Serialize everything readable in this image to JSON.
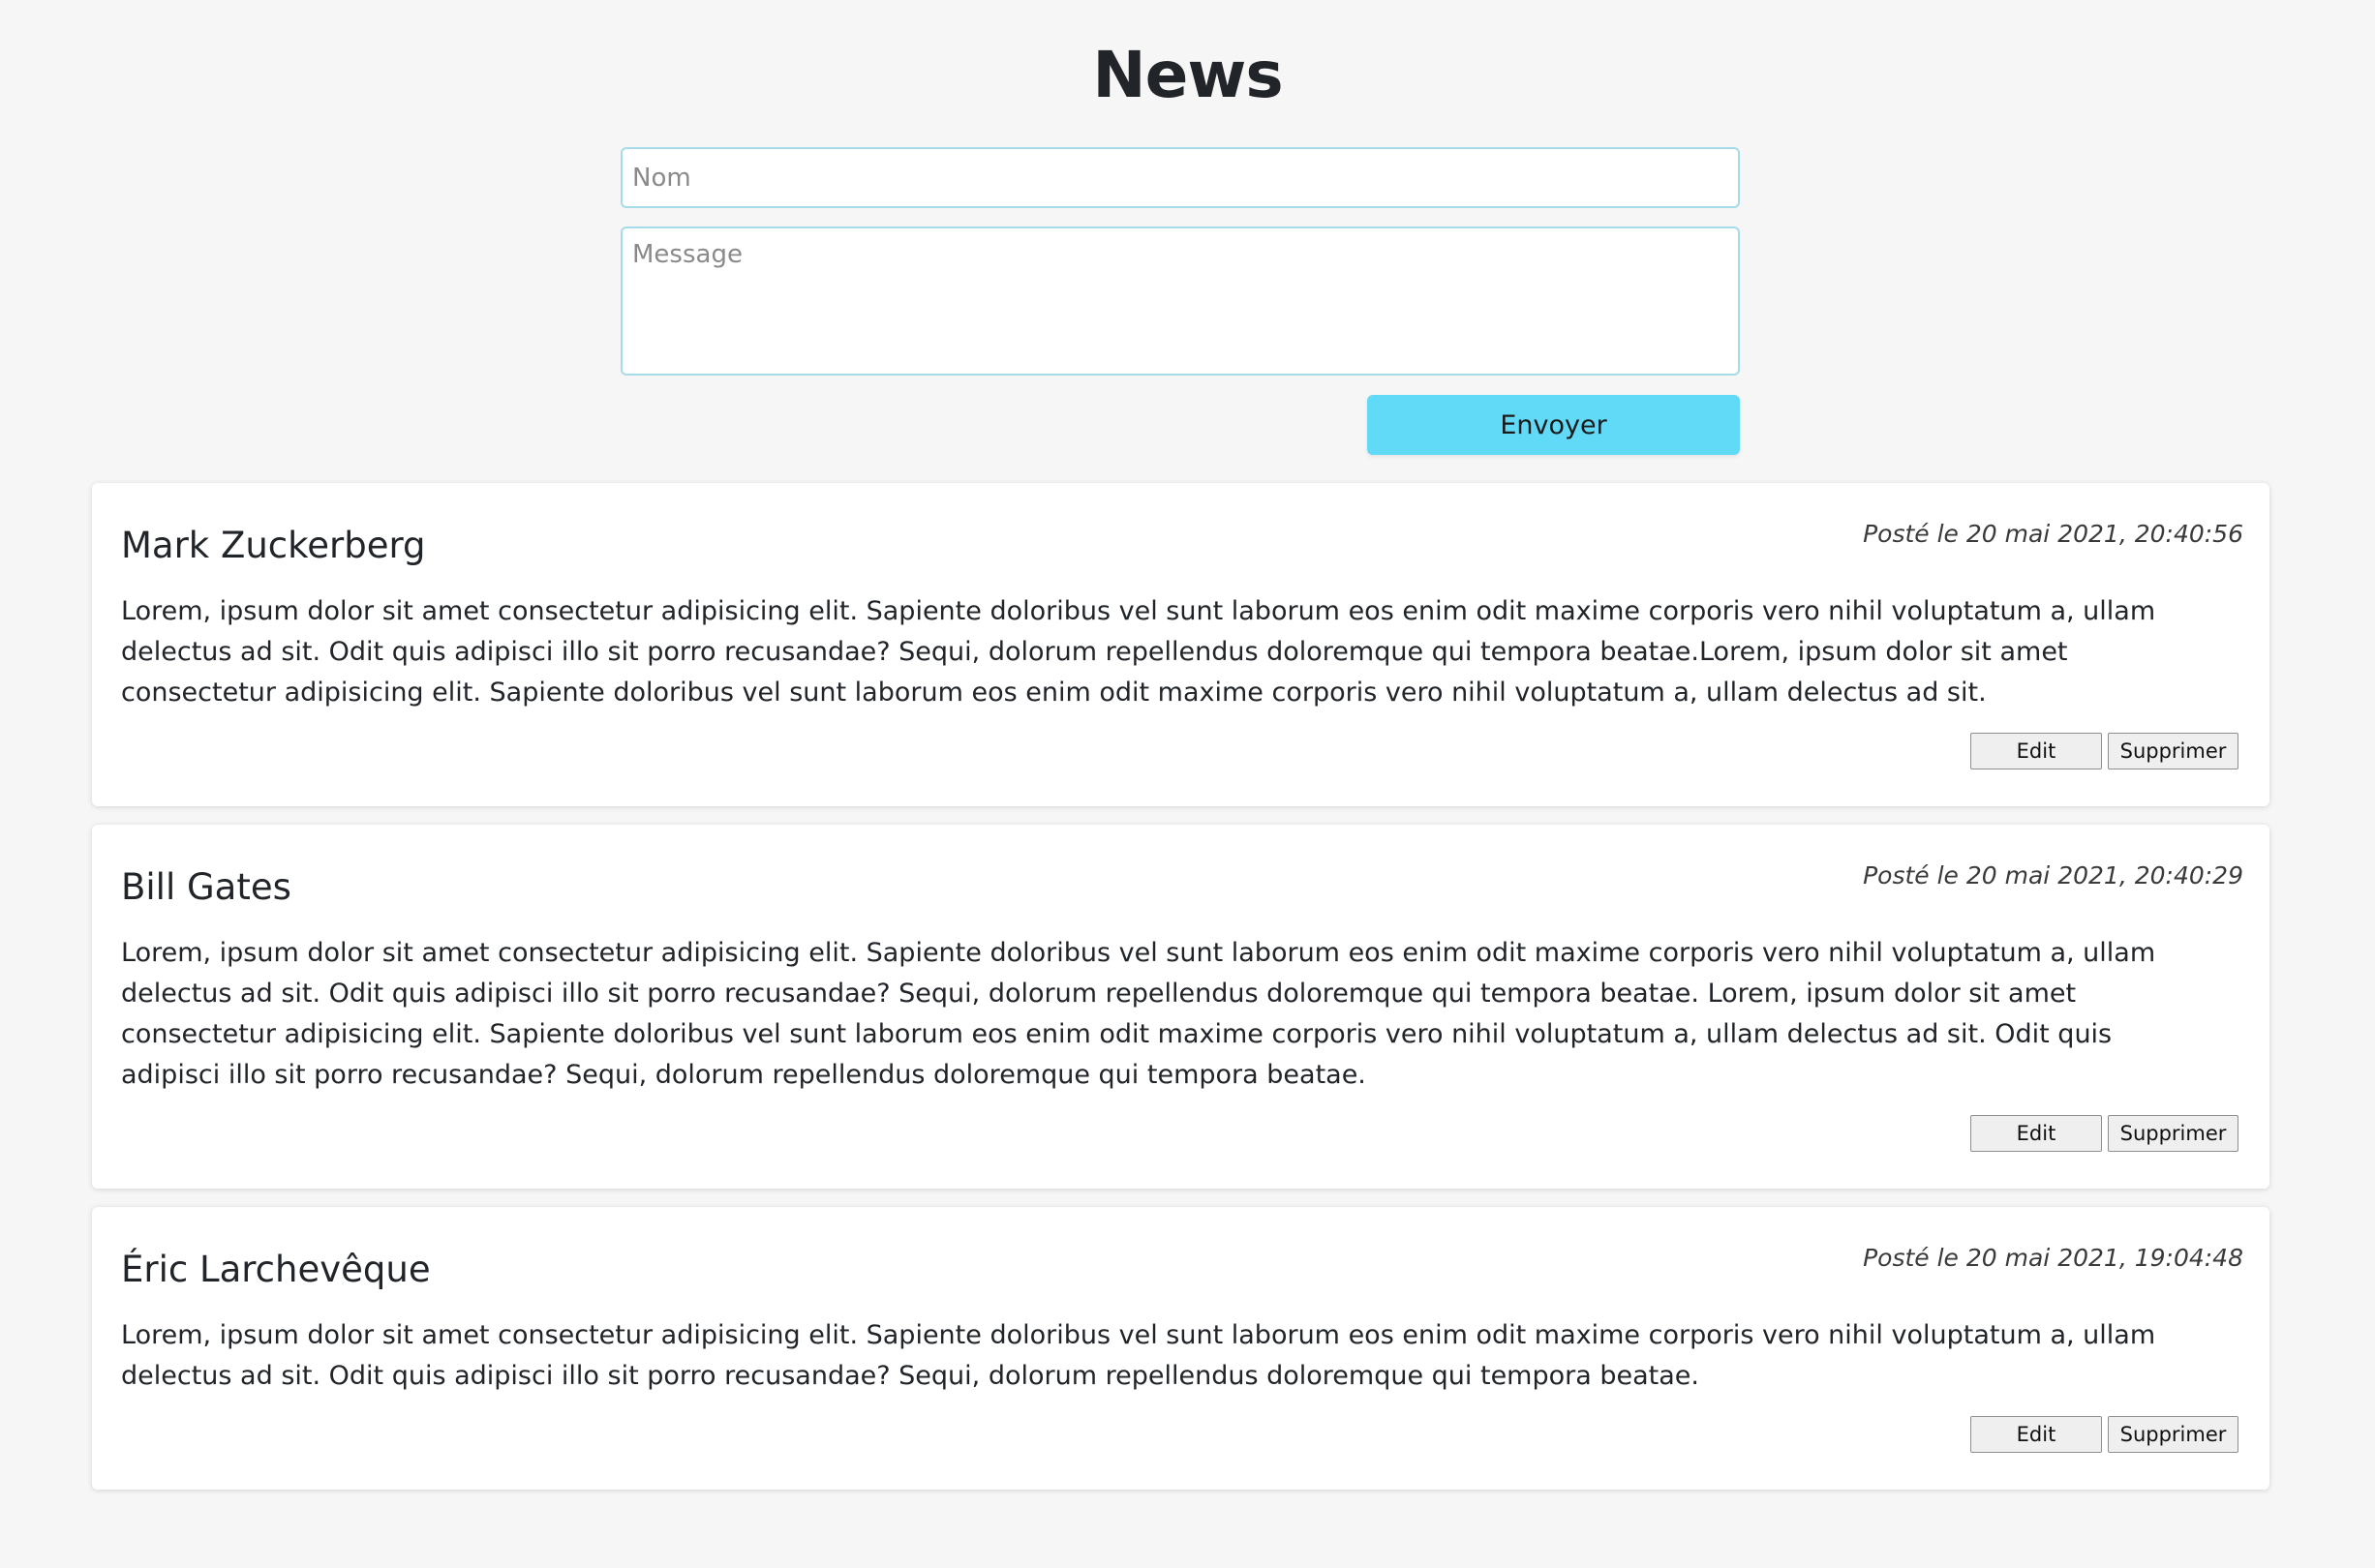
{
  "page": {
    "title": "News"
  },
  "form": {
    "name_placeholder": "Nom",
    "name_value": "",
    "message_placeholder": "Message",
    "message_value": "",
    "submit_label": "Envoyer"
  },
  "colors": {
    "accent": "#61daf8",
    "input_border": "#a6dce9",
    "background": "#f6f6f6"
  },
  "posts": [
    {
      "author": "Mark Zuckerberg",
      "date": "Posté le 20 mai 2021, 20:40:56",
      "body": "Lorem, ipsum dolor sit amet consectetur adipisicing elit. Sapiente doloribus vel sunt laborum eos enim odit maxime corporis vero nihil voluptatum a, ullam delectus ad sit. Odit quis adipisci illo sit porro recusandae? Sequi, dolorum repellendus doloremque qui tempora beatae.Lorem, ipsum dolor sit amet consectetur adipisicing elit. Sapiente doloribus vel sunt laborum eos enim odit maxime corporis vero nihil voluptatum a, ullam delectus ad sit.",
      "edit_label": "Edit",
      "delete_label": "Supprimer"
    },
    {
      "author": "Bill Gates",
      "date": "Posté le 20 mai 2021, 20:40:29",
      "body": "Lorem, ipsum dolor sit amet consectetur adipisicing elit. Sapiente doloribus vel sunt laborum eos enim odit maxime corporis vero nihil voluptatum a, ullam delectus ad sit. Odit quis adipisci illo sit porro recusandae? Sequi, dolorum repellendus doloremque qui tempora beatae. Lorem, ipsum dolor sit amet consectetur adipisicing elit. Sapiente doloribus vel sunt laborum eos enim odit maxime corporis vero nihil voluptatum a, ullam delectus ad sit. Odit quis adipisci illo sit porro recusandae? Sequi, dolorum repellendus doloremque qui tempora beatae.",
      "edit_label": "Edit",
      "delete_label": "Supprimer"
    },
    {
      "author": "Éric Larchevêque",
      "date": "Posté le 20 mai 2021, 19:04:48",
      "body": "Lorem, ipsum dolor sit amet consectetur adipisicing elit. Sapiente doloribus vel sunt laborum eos enim odit maxime corporis vero nihil voluptatum a, ullam delectus ad sit. Odit quis adipisci illo sit porro recusandae? Sequi, dolorum repellendus doloremque qui tempora beatae.",
      "edit_label": "Edit",
      "delete_label": "Supprimer"
    }
  ]
}
